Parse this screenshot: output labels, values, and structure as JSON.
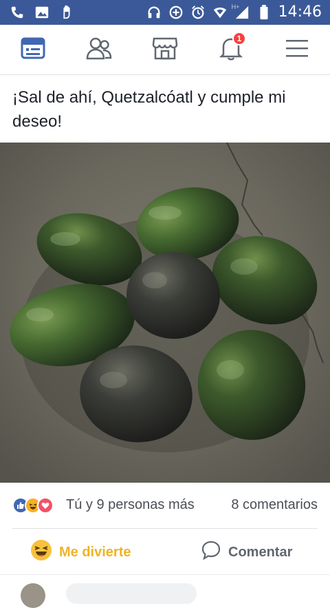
{
  "status_bar": {
    "time": "14:46",
    "network_label": "H+",
    "icons": [
      "phone-icon",
      "gallery-icon",
      "hand-icon",
      "headset-icon",
      "data-saver-icon",
      "alarm-icon",
      "wifi-icon",
      "signal-icon",
      "battery-icon"
    ]
  },
  "nav": {
    "items": [
      "feed-icon",
      "friends-icon",
      "marketplace-icon",
      "notifications-icon",
      "menu-icon"
    ],
    "notification_count": "1",
    "accent": "#4267b2"
  },
  "post": {
    "text": "¡Sal de ahí, Quetzalcóatl y cumple mi deseo!",
    "image": "avocados",
    "reaction_summary": "Tú y 9 personas más",
    "comment_count": "8 comentarios",
    "actions": {
      "react_label": "Me divierte",
      "comment_label": "Comentar"
    },
    "reaction_icons": [
      "like-reaction-icon",
      "haha-reaction-icon",
      "love-reaction-icon"
    ],
    "colors": {
      "haha": "#f7b125",
      "like": "#4267b2",
      "love": "#f25268"
    }
  }
}
